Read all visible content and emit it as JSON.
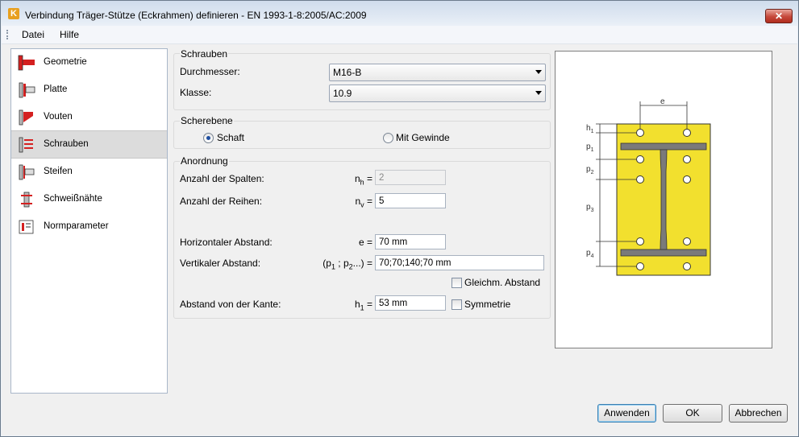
{
  "window": {
    "title": "Verbindung Träger-Stütze (Eckrahmen) definieren - EN 1993-1-8:2005/AC:2009",
    "close_label": "✕"
  },
  "menu": {
    "items": [
      {
        "label": "Datei"
      },
      {
        "label": "Hilfe"
      }
    ]
  },
  "nav": {
    "selected_index": 3,
    "items": [
      {
        "label": "Geometrie",
        "icon": "geometry-icon"
      },
      {
        "label": "Platte",
        "icon": "plate-icon"
      },
      {
        "label": "Vouten",
        "icon": "haunch-icon"
      },
      {
        "label": "Schrauben",
        "icon": "bolts-icon"
      },
      {
        "label": "Steifen",
        "icon": "stiffener-icon"
      },
      {
        "label": "Schweißnähte",
        "icon": "welds-icon"
      },
      {
        "label": "Normparameter",
        "icon": "code-parameters-icon"
      }
    ]
  },
  "schrauben": {
    "group_title": "Schrauben",
    "durchmesser_label": "Durchmesser:",
    "durchmesser_value": "M16-B",
    "klasse_label": "Klasse:",
    "klasse_value": "10.9"
  },
  "scherebene": {
    "group_title": "Scherebene",
    "option_schaft": "Schaft",
    "option_gewinde": "Mit Gewinde",
    "selected": "Schaft"
  },
  "anordnung": {
    "group_title": "Anordnung",
    "spalten_label": "Anzahl der Spalten:",
    "spalten_sym": "n",
    "spalten_sub": "h",
    "spalten_eq": "=",
    "spalten_value": "2",
    "reihen_label": "Anzahl der Reihen:",
    "reihen_sym": "n",
    "reihen_sub": "v",
    "reihen_eq": "=",
    "reihen_value": "5",
    "horiz_label": "Horizontaler Abstand:",
    "horiz_sym": "e =",
    "horiz_value": "70 mm",
    "vert_label": "Vertikaler Abstand:",
    "vert_sym_a": "(p",
    "vert_sub_a": "1",
    "vert_sym_b": " ; p",
    "vert_sub_b": "2",
    "vert_sym_c": "...) =",
    "vert_value": "70;70;140;70 mm",
    "gleich_label": "Gleichm. Abstand",
    "kante_label": "Abstand von der Kante:",
    "kante_sym": "h",
    "kante_sub": "1",
    "kante_eq": "=",
    "kante_value": "53 mm",
    "symmetrie_label": "Symmetrie"
  },
  "preview": {
    "label_e": "e",
    "label_h1": "h",
    "label_h1_sub": "1",
    "label_p1": "p",
    "label_p1_sub": "1",
    "label_p2": "p",
    "label_p2_sub": "2",
    "label_p3": "p",
    "label_p3_sub": "3",
    "label_p4": "p",
    "label_p4_sub": "4",
    "plate_color": "#f2e02e",
    "beam_color": "#7a7a7a"
  },
  "buttons": {
    "apply": "Anwenden",
    "ok": "OK",
    "cancel": "Abbrechen"
  }
}
